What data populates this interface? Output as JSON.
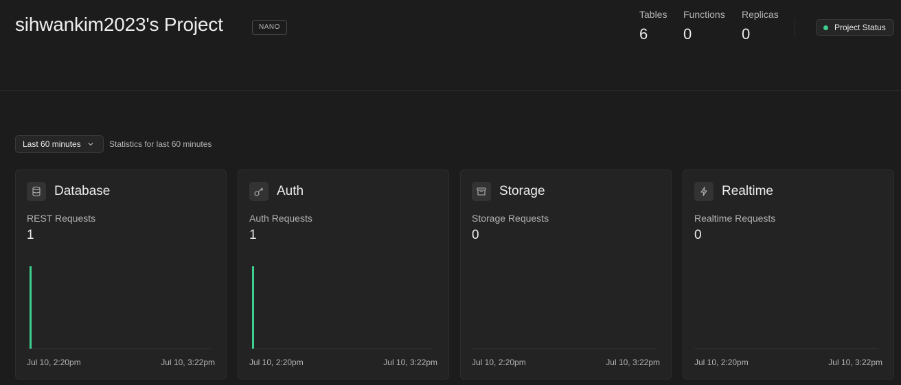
{
  "header": {
    "title": "sihwankim2023's Project",
    "plan_badge": "NANO",
    "stats": [
      {
        "label": "Tables",
        "value": "6"
      },
      {
        "label": "Functions",
        "value": "0"
      },
      {
        "label": "Replicas",
        "value": "0"
      }
    ],
    "status_button": {
      "label": "Project Status",
      "indicator_color": "#3ecf8e"
    }
  },
  "filters": {
    "range_label": "Last 60 minutes",
    "range_description": "Statistics for last 60 minutes"
  },
  "cards": [
    {
      "title": "Database",
      "icon": "database-icon",
      "metric_label": "REST Requests",
      "metric_value": "1",
      "start_time": "Jul 10, 2:20pm",
      "end_time": "Jul 10, 3:22pm"
    },
    {
      "title": "Auth",
      "icon": "key-icon",
      "metric_label": "Auth Requests",
      "metric_value": "1",
      "start_time": "Jul 10, 2:20pm",
      "end_time": "Jul 10, 3:22pm"
    },
    {
      "title": "Storage",
      "icon": "archive-icon",
      "metric_label": "Storage Requests",
      "metric_value": "0",
      "start_time": "Jul 10, 2:20pm",
      "end_time": "Jul 10, 3:22pm"
    },
    {
      "title": "Realtime",
      "icon": "lightning-icon",
      "metric_label": "Realtime Requests",
      "metric_value": "0",
      "start_time": "Jul 10, 2:20pm",
      "end_time": "Jul 10, 3:22pm"
    }
  ],
  "chart_data": [
    {
      "type": "bar",
      "title": "REST Requests",
      "x_range": [
        "Jul 10, 2:20pm",
        "Jul 10, 3:22pm"
      ],
      "x": [
        "Jul 10, 2:20pm"
      ],
      "values": [
        1
      ],
      "ylim": [
        0,
        1
      ],
      "color": "#3ecf8e"
    },
    {
      "type": "bar",
      "title": "Auth Requests",
      "x_range": [
        "Jul 10, 2:20pm",
        "Jul 10, 3:22pm"
      ],
      "x": [
        "Jul 10, 2:20pm"
      ],
      "values": [
        1
      ],
      "ylim": [
        0,
        1
      ],
      "color": "#3ecf8e"
    },
    {
      "type": "bar",
      "title": "Storage Requests",
      "x_range": [
        "Jul 10, 2:20pm",
        "Jul 10, 3:22pm"
      ],
      "x": [],
      "values": [],
      "ylim": [
        0,
        1
      ],
      "color": "#3ecf8e"
    },
    {
      "type": "bar",
      "title": "Realtime Requests",
      "x_range": [
        "Jul 10, 2:20pm",
        "Jul 10, 3:22pm"
      ],
      "x": [],
      "values": [],
      "ylim": [
        0,
        1
      ],
      "color": "#3ecf8e"
    }
  ]
}
